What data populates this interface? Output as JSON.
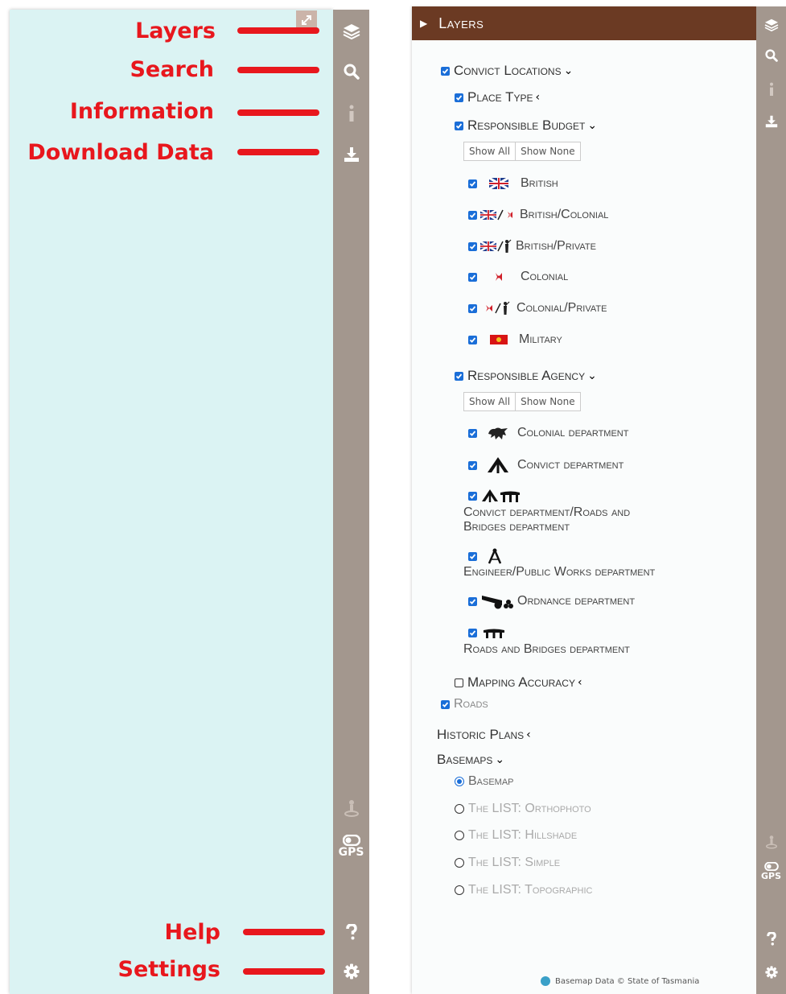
{
  "annotations": {
    "layers": "Layers",
    "search": "Search",
    "information": "Information",
    "download": "Download Data",
    "help": "Help",
    "settings": "Settings"
  },
  "gps_label": "GPS",
  "panel": {
    "title": "Layers",
    "convict_locations": "Convict Locations",
    "place_type": "Place Type",
    "responsible_budget": "Responsible Budget",
    "responsible_agency": "Responsible Agency",
    "show_all": "Show All",
    "show_none": "Show None",
    "budget_items": [
      "British",
      "British/Colonial",
      "British/Private",
      "Colonial",
      "Colonial/Private",
      "Military"
    ],
    "agency_items": [
      "Colonial department",
      "Convict department",
      "Convict department/Roads and Bridges department",
      "Engineer/Public Works department",
      "Ordnance department",
      "Roads and Bridges department"
    ],
    "agency_line1": "Convict department/Roads and",
    "agency_line2": "Bridges department",
    "mapping_accuracy": "Mapping Accuracy",
    "roads": "Roads",
    "historic_plans": "Historic Plans",
    "basemaps": "Basemaps",
    "basemap_options": [
      "Basemap",
      "The LIST: Orthophoto",
      "The LIST: Hillshade",
      "The LIST: Simple",
      "The LIST: Topographic"
    ],
    "footer": "Basemap Data © State of Tasmania"
  },
  "colors": {
    "toolbar": "#a3978e",
    "header": "#6b3a23",
    "annotation": "#e8171d",
    "left_bg": "#dbf3f3",
    "checkbox": "#1a6ed8"
  },
  "icons": [
    "layers-icon",
    "search-icon",
    "info-icon",
    "download-icon",
    "location-icon",
    "gps-icon",
    "help-icon",
    "settings-icon",
    "expand-icon"
  ]
}
